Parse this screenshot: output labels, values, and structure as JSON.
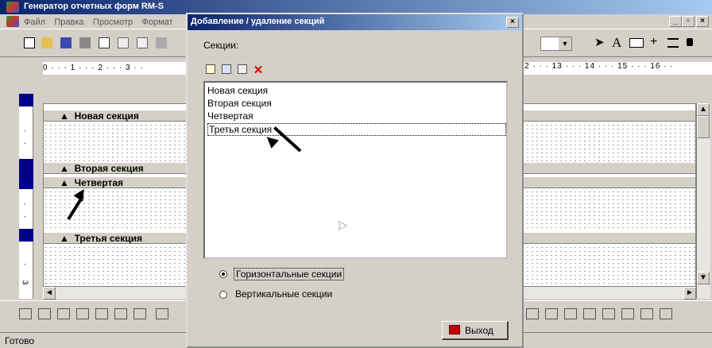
{
  "main_window": {
    "title": "Генератор отчетных форм RM-S",
    "menu": [
      "Файл",
      "Правка",
      "Просмотр",
      "Формат"
    ],
    "controls": [
      "_",
      "□",
      "×"
    ]
  },
  "ruler": {
    "text": "0 · · · 1 · · · 2 · · · 3 · ·",
    "text_right": "2 · · · 13 · · · 14 · · · 15 · · · 16 · ·"
  },
  "design_bands": [
    {
      "label": "Новая секция"
    },
    {
      "label": "Вторая секция"
    },
    {
      "label": "Четвертая"
    },
    {
      "label": "Третья секция"
    }
  ],
  "status": {
    "text": "Готово"
  },
  "dialog": {
    "title": "Добавление / удаление секций",
    "close": "×",
    "sections_label": "Секции:",
    "sections": [
      "Новая секция",
      "Вторая секция",
      "Четвертая",
      "Третья секция"
    ],
    "selected_index": 3,
    "radio_horizontal": "Горизонтальные секции",
    "radio_vertical": "Вертикальные секции",
    "selected_orientation": "horizontal",
    "exit_label": "Выход",
    "delete_symbol": "✕"
  },
  "icons": {
    "app": "report-generator-app-icon",
    "add_section": "new-section-icon",
    "copy_section": "copy-section-icon",
    "properties": "properties-icon",
    "delete": "delete-icon",
    "exit": "exit-icon"
  },
  "colors": {
    "titlebar_start": "#0a246a",
    "titlebar_end": "#a6caf0",
    "face": "#d4d0c8",
    "delete_red": "#e00000",
    "band_marker": "#00008b"
  }
}
